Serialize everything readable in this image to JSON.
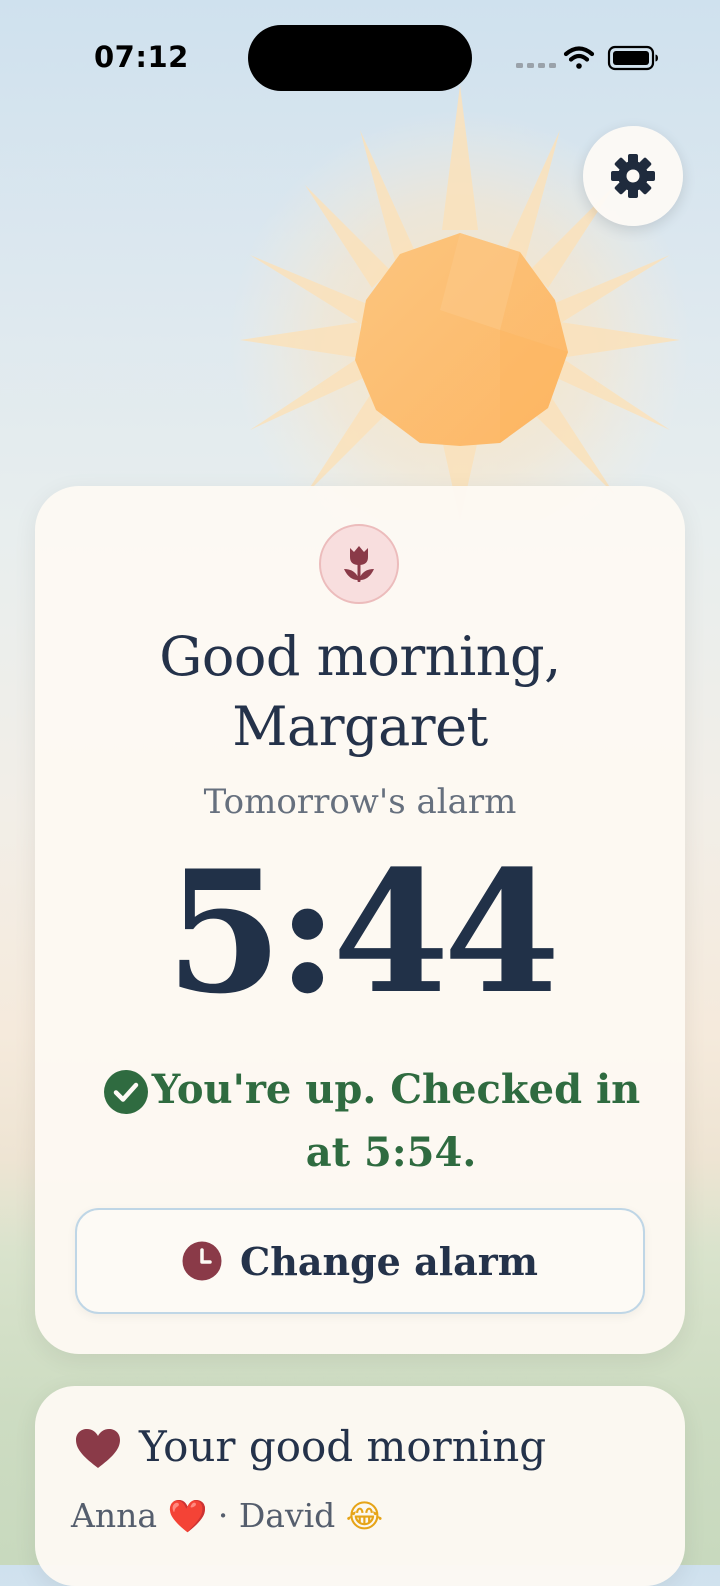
{
  "status_bar": {
    "time": "07:12"
  },
  "icons": {
    "settings": "gear-icon",
    "badge": "tulip-icon",
    "checkin": "check-circle-icon",
    "change": "clock-icon",
    "messages": "heart-icon"
  },
  "colors": {
    "accent_red": "#8a3a48",
    "success_green": "#2f6b40",
    "text_dark": "#24324a",
    "sun_orange": "#fdbb6c"
  },
  "main_card": {
    "greeting_line1": "Good morning,",
    "greeting_line2": "Margaret",
    "alarm_label": "Tomorrow's alarm",
    "alarm_time": "5:44",
    "checkin_line1": "You're up. Checked in",
    "checkin_line2": "at 5:54.",
    "change_button_label": "Change alarm"
  },
  "morning_card": {
    "title": "Your good morning",
    "names_prefix": "Anna",
    "names_middle": " · David ",
    "emoji_1": "❤️",
    "emoji_2": "😂"
  }
}
